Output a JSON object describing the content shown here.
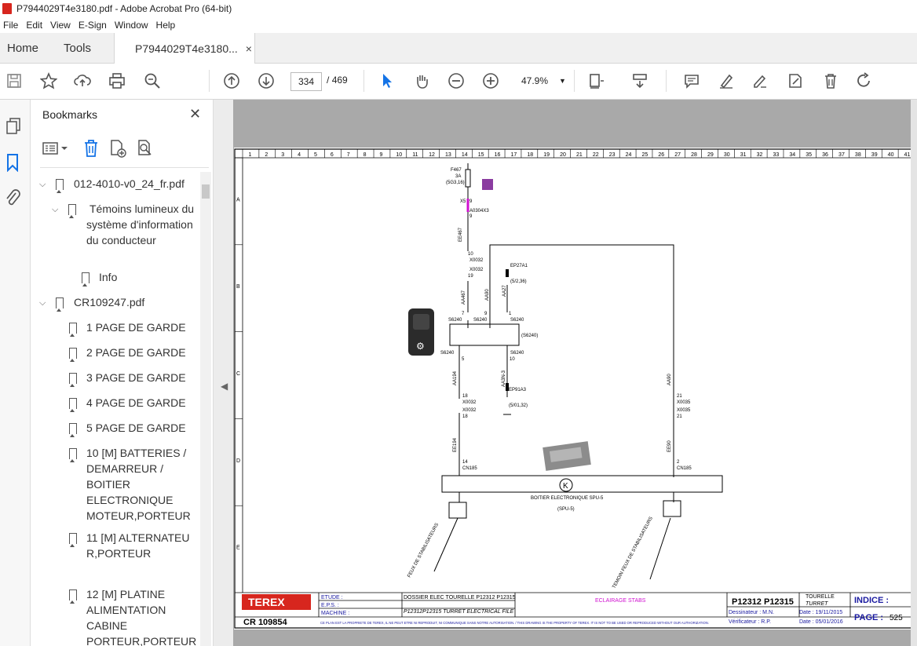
{
  "window": {
    "title": "P7944029T4e3180.pdf - Adobe Acrobat Pro (64-bit)"
  },
  "menu": [
    "File",
    "Edit",
    "View",
    "E-Sign",
    "Window",
    "Help"
  ],
  "tabs": {
    "home": "Home",
    "tools": "Tools",
    "document": "P7944029T4e3180...",
    "close": "×"
  },
  "toolbar": {
    "page_current": "334",
    "page_separator": "/",
    "page_total": "469",
    "zoom": "47.9%"
  },
  "bookmarks": {
    "title": "Bookmarks",
    "items": [
      {
        "label": "012-4010-v0_24_fr.pdf",
        "level": 0,
        "expanded": true
      },
      {
        "label": "Témoins lumineux du système d'information du conducteur",
        "level": 1,
        "expanded": true
      },
      {
        "label": "Info",
        "level": 2
      },
      {
        "label": "CR109247.pdf",
        "level": 0,
        "expanded": true
      },
      {
        "label": "1 PAGE DE GARDE",
        "level": 1
      },
      {
        "label": "2 PAGE DE GARDE",
        "level": 1
      },
      {
        "label": "3 PAGE DE GARDE",
        "level": 1
      },
      {
        "label": "4 PAGE DE GARDE",
        "level": 1
      },
      {
        "label": "5 PAGE DE GARDE",
        "level": 1
      },
      {
        "label": "10 [M] BATTERIES / DEMARREUR / BOITIER ELECTRONIQUE MOTEUR,PORTEUR",
        "level": 1
      },
      {
        "label": "11 [M] ALTERNATEUR,PORTEUR",
        "level": 1
      },
      {
        "label": "12 [M] PLATINE ALIMENTATION CABINE PORTEUR,PORTEUR",
        "level": 1
      }
    ]
  },
  "drawing": {
    "column_numbers": [
      "1",
      "2",
      "3",
      "4",
      "5",
      "6",
      "7",
      "8",
      "9",
      "10",
      "11",
      "12",
      "13",
      "14",
      "15",
      "16",
      "17",
      "18",
      "19",
      "20",
      "21",
      "22",
      "23",
      "24",
      "25",
      "26",
      "27",
      "28",
      "29",
      "30",
      "31",
      "32",
      "33",
      "34",
      "35",
      "36",
      "37",
      "38",
      "39",
      "40",
      "41"
    ],
    "row_letters": [
      "A",
      "B",
      "C",
      "D",
      "E"
    ],
    "fuse": {
      "name": "F467",
      "rating": "3A",
      "ref": "(5G3,16)"
    },
    "wires": [
      "EE467",
      "AA467",
      "AA90",
      "AA27",
      "AA194",
      "AA3N-3",
      "EE194",
      "AA90",
      "EE90"
    ],
    "connectors": [
      "X0304X3",
      "X0032",
      "S6240",
      "X0035",
      "CN185",
      "EP27A1",
      "EP91A3"
    ],
    "labels": {
      "fuse_pin_a": "X5",
      "fuse_pin_b": "9",
      "fuse_conn": "A0304X3",
      "fuse_conn_pin": "9",
      "x0032_top_a": "10",
      "x0032_top_name": "X0032",
      "x0032_top_name2": "X0032",
      "x0032_top_b": "19",
      "ep27a1": "EP27A1",
      "ep27a1_ref": "(5/2,36)",
      "s6240": "S6240",
      "s6240_ref": "(S6240)",
      "x0032_bot_a": "18",
      "x0032_bot_b": "18",
      "ep91a3": "EP91A3",
      "ep91a3_ref": "(5/01,32)",
      "x0035_a": "21",
      "x0035_name": "X0035",
      "x0035_name2": "X0035",
      "x0035_b": "21",
      "cn185_left_pin": "14",
      "cn185_right_pin": "2",
      "cn185": "CN185",
      "spu5": "BOITIER ELECTRONIQUE SPU-5",
      "spu5_tag": "(SPU-5)",
      "lamp_left": "FEUX DE STABILISATEURS",
      "lamp_right": "TEMOIN FEUX DE STABILISATEURS",
      "pin_labels": [
        "7",
        "9",
        "1",
        "5",
        "10"
      ]
    },
    "title_block": {
      "brand": "TEREX",
      "etude_label": "ETUDE :",
      "eps_label": "E.P.S. :",
      "machine_label": "MACHINE :",
      "etude_value": "DOSSIER ELEC TOURELLE P12312 P12315",
      "machine_value": "P12312P12315 TURRET ELECTRICAL FILE",
      "function": "ECLAIRAGE STABS",
      "model": "P12312 P12315",
      "tourelle": "TOURELLE",
      "turret": "TURRET",
      "indice": "INDICE :",
      "dessinateur": "Dessinateur : M.N.",
      "verificateur": "Vérificateur : R.P.",
      "date1": "Date : 19/11/2015",
      "date2": "Date : 05/01/2016",
      "page_label": "PAGE :",
      "page_value": "525",
      "ref": "CR 109854",
      "disclaimer": "CE PLAN EST LA PROPRIETE DE TEREX, IL NE PEUT ETRE NI REPRODUIT, NI COMMUNIQUE SANS NOTRE AUTORISATION. / THIS DRAWING IS THE PROPERTY OF TEREX. IT IS NOT TO BE USED OR REPRODUCED WITHOUT OUR AUTHORIZATION."
    }
  }
}
